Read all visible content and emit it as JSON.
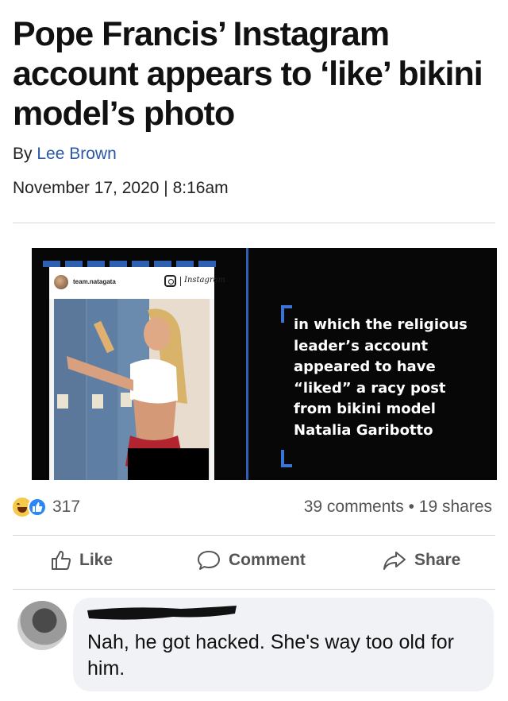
{
  "article": {
    "headline": "Pope Francis’ Instagram account appears to ‘like’ bikini model’s photo",
    "by_prefix": "By",
    "author": "Lee Brown",
    "date": "November 17, 2020 | 8:16am"
  },
  "media": {
    "instagram_username": "team.natagata",
    "instagram_wordmark": "Instagram",
    "caption": "in which the religious leader’s account appeared to have “liked” a racy post from bikini model Natalia Garibotto"
  },
  "post_stats": {
    "reactions_icons": [
      "haha-reaction-icon",
      "like-reaction-icon"
    ],
    "reaction_count": "317",
    "comments_shares": "39 comments • 19 shares"
  },
  "actions": {
    "like": "Like",
    "comment": "Comment",
    "share": "Share"
  },
  "comment": {
    "text": "Nah, he got hacked. She's way too old for him."
  },
  "colors": {
    "author_link": "#2b59a8",
    "accent_blue": "#3a74d6",
    "like_reaction": "#2d86f5",
    "bubble": "#f0f2f5"
  }
}
